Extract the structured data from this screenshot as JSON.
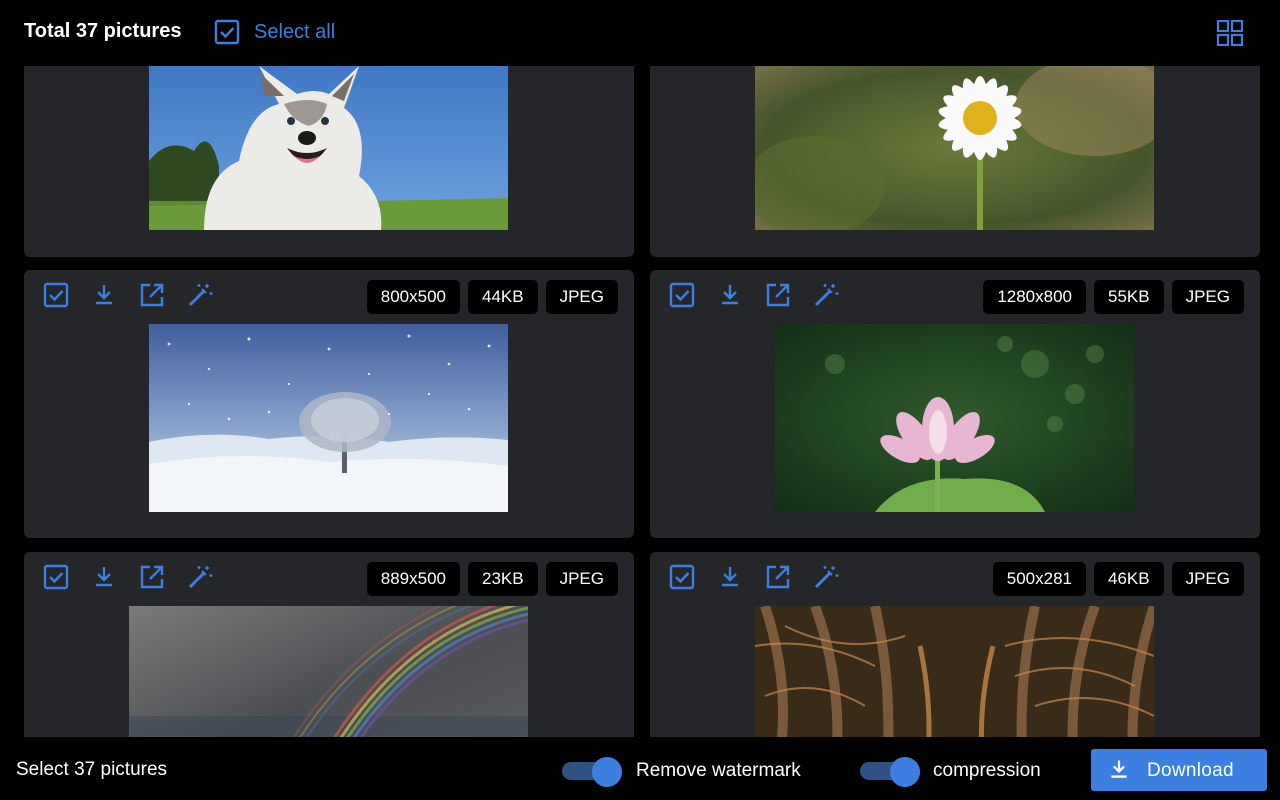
{
  "header": {
    "total_label": "Total 37 pictures",
    "select_all_label": "Select all"
  },
  "cards": [
    {
      "id": "husky",
      "size": "",
      "filesize": "",
      "format": "",
      "image": "husky puppy on grass with blue sky"
    },
    {
      "id": "daisy",
      "size": "",
      "filesize": "",
      "format": "",
      "image": "white daisy flower"
    },
    {
      "id": "snow-tree",
      "size": "800x500",
      "filesize": "44KB",
      "format": "JPEG",
      "image": "snowy tree landscape"
    },
    {
      "id": "lotus",
      "size": "1280x800",
      "filesize": "55KB",
      "format": "JPEG",
      "image": "pink lotus flower"
    },
    {
      "id": "rainbow",
      "size": "889x500",
      "filesize": "23KB",
      "format": "JPEG",
      "image": "double rainbow in grey sky"
    },
    {
      "id": "tree-alley",
      "size": "500x281",
      "filesize": "46KB",
      "format": "JPEG",
      "image": "alley of old trees"
    }
  ],
  "footer": {
    "select_count_label": "Select 37 pictures",
    "remove_watermark_label": "Remove watermark",
    "compression_label": "compression",
    "download_label": "Download"
  },
  "icons": [
    "checkbox-icon",
    "download-icon",
    "open-external-icon",
    "magic-wand-icon",
    "grid-view-icon"
  ],
  "colors": {
    "accent": "#3d7fe0",
    "card": "#252629",
    "background": "#000000"
  }
}
